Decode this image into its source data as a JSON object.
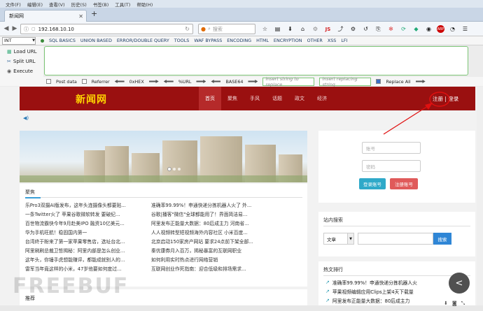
{
  "menubar": [
    "文件(F)",
    "编辑(E)",
    "查看(V)",
    "历史(S)",
    "书签(B)",
    "工具(T)",
    "帮助(H)"
  ],
  "tab": {
    "title": "新闻网"
  },
  "newtab_symbol": "+",
  "navbar": {
    "url": "192.168.10.10",
    "search_placeholder": "搜索",
    "js_label": "JS",
    "adblock_label": "ABP"
  },
  "hackbar": {
    "int_value": "INT",
    "menus": [
      "SQL BASICS",
      "UNION BASED",
      "ERROR/DOUBLE QUERY",
      "TOOLS",
      "WAF BYPASS",
      "ENCODING",
      "HTML",
      "ENCRYPTION",
      "OTHER",
      "XSS",
      "LFI"
    ],
    "actions": [
      "Load URL",
      "Split URL",
      "Execute"
    ],
    "options": {
      "post_data": "Post data",
      "referrer": "Referrer",
      "hex": "0xHEX",
      "url": "%URL",
      "base64": "BASE64",
      "replace_from_placeholder": "Insert string to replace",
      "replace_to_placeholder": "Insert replacing string",
      "replace_all": "Replace All"
    }
  },
  "site": {
    "logo": "新闻网",
    "nav": [
      "首页",
      "聚焦",
      "手风",
      "话题",
      "政文",
      "经济"
    ],
    "register": "注册",
    "separator": "|",
    "login": "登录",
    "news_heading": "聚焦",
    "news_left": [
      "乐Pro3双摄AI版发布，这年头连摄像头都要贴...",
      "一条Twitter火了 苹果谷歌微软转发 要破纪...",
      "百世物流霸快今年9月赴美IPO 融资10亿美元...",
      "华为手机旺航！稳固国内第一",
      "台湾终于盼来了第一家苹果零售店，选址台北...",
      "阿里刷刷总裁卫哲揭秘：阿里内部是怎么创业...",
      "这年头，你锤手虎想能赚评，都能成就别人的...",
      "雷军当年竟这样的小米，47岁他要如何度过..."
    ],
    "news_right": [
      "准确率99.99%！申通快递分拣机器人火了 外...",
      "谷歌|播客\"微信\"全球都能用了！界面简洁易...",
      "阿里发布正能量大数据：80后成主力 河南省...",
      "人人视频转型短视频海外内容社区 小米百度...",
      "北京启动150家房产网站 要求24点前下架全部...",
      "秦优康券月入百万，揭秘暴富的互联网职业",
      "如何利用实时热点进行网络营销",
      "互联网创业作死指南：迎合低级和排场需求..."
    ],
    "login_box": {
      "username_placeholder": "账号",
      "password_placeholder": "密码",
      "login_btn": "登录账号",
      "register_btn": "注册账号"
    },
    "search": {
      "title": "站内搜索",
      "select_value": "文章",
      "button": "搜索"
    },
    "hot": {
      "title": "热文排行",
      "items": [
        "准确率99.99%！申通快递分拣机器人火",
        "苹果视频编辑应用Clips上架4天下载量",
        "阿里发布正能量大数据：80后成主力"
      ]
    },
    "partial_heading": "推荐"
  },
  "watermark": "FREEBUF",
  "share_symbol": "<",
  "colors": {
    "header_red": "#9a1010",
    "logo_yellow": "#ffd400",
    "login_btn": "#2fa9c9",
    "register_btn": "#e05a5a",
    "annotation": "#e01010"
  }
}
